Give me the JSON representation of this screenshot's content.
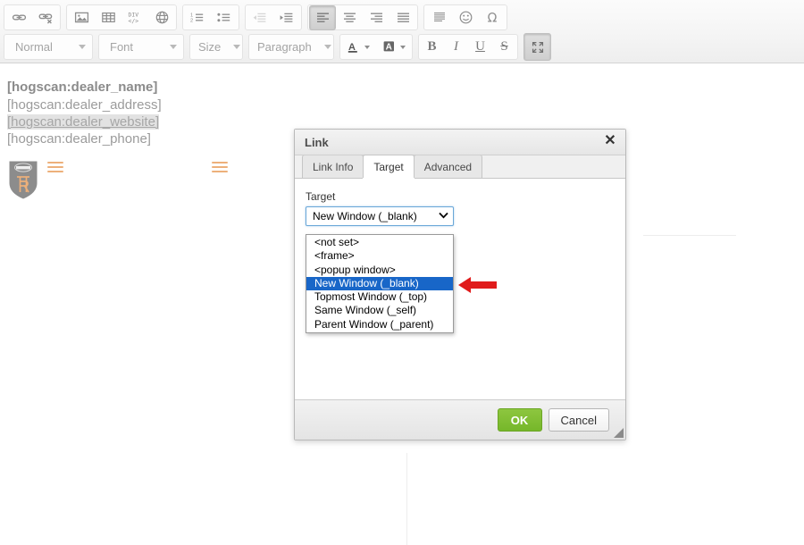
{
  "toolbar": {
    "row1_groups": [
      {
        "name": "link-group",
        "buttons": [
          {
            "icon": "link-icon",
            "label": "Link",
            "state": "normal"
          },
          {
            "icon": "unlink-icon",
            "label": "Unlink",
            "state": "normal"
          }
        ]
      },
      {
        "name": "insert-group",
        "buttons": [
          {
            "icon": "image-icon",
            "label": "Image",
            "state": "normal"
          },
          {
            "icon": "table-icon",
            "label": "Table",
            "state": "normal"
          },
          {
            "icon": "div-container-icon",
            "label": "Div Container",
            "state": "normal"
          },
          {
            "icon": "iframe-icon",
            "label": "IFrame",
            "state": "normal"
          }
        ]
      },
      {
        "name": "list-group",
        "buttons": [
          {
            "icon": "numbered-list-icon",
            "label": "Insert/Remove Numbered List",
            "state": "normal"
          },
          {
            "icon": "bulleted-list-icon",
            "label": "Insert/Remove Bulleted List",
            "state": "normal"
          }
        ]
      },
      {
        "name": "indent-group",
        "buttons": [
          {
            "icon": "outdent-icon",
            "label": "Decrease Indent",
            "state": "disabled"
          },
          {
            "icon": "indent-icon",
            "label": "Increase Indent",
            "state": "normal"
          }
        ]
      },
      {
        "name": "align-group",
        "buttons": [
          {
            "icon": "align-left-icon",
            "label": "Align Left",
            "state": "active"
          },
          {
            "icon": "align-center-icon",
            "label": "Center",
            "state": "normal"
          },
          {
            "icon": "align-right-icon",
            "label": "Align Right",
            "state": "normal"
          },
          {
            "icon": "align-justify-icon",
            "label": "Justify",
            "state": "normal"
          }
        ]
      },
      {
        "name": "misc-group",
        "buttons": [
          {
            "icon": "blockquote-icon",
            "label": "Block Quote",
            "state": "normal"
          },
          {
            "icon": "smiley-icon",
            "label": "Smiley",
            "state": "normal"
          },
          {
            "icon": "special-char-icon",
            "label": "Insert Special Character",
            "state": "normal"
          }
        ]
      }
    ],
    "combos": {
      "format": "Normal",
      "font": "Font",
      "size": "Size",
      "paragraph": "Paragraph"
    },
    "color_buttons": [
      {
        "icon": "text-color-icon",
        "label": "Text Color",
        "glyph": "A"
      },
      {
        "icon": "background-color-icon",
        "label": "Background Color",
        "glyph": "A"
      }
    ],
    "format_buttons": [
      {
        "icon": "bold-icon",
        "label": "Bold",
        "glyph": "B"
      },
      {
        "icon": "italic-icon",
        "label": "Italic",
        "glyph": "I"
      },
      {
        "icon": "underline-icon",
        "label": "Underline",
        "glyph": "U"
      },
      {
        "icon": "strikethrough-icon",
        "label": "Strike Through",
        "glyph": "S"
      }
    ],
    "maximize": {
      "icon": "maximize-icon",
      "label": "Maximize",
      "state": "normal"
    }
  },
  "editor": {
    "tokens": [
      "[hogscan:dealer_name]",
      "[hogscan:dealer_address]",
      "[hogscan:dealer_website]",
      "[hogscan:dealer_phone]"
    ],
    "logo_alt": "dealer-shield-logo"
  },
  "dialog": {
    "title": "Link",
    "close_label": "✕",
    "tabs": [
      {
        "label": "Link Info",
        "active": false
      },
      {
        "label": "Target",
        "active": true
      },
      {
        "label": "Advanced",
        "active": false
      }
    ],
    "target_field": {
      "label": "Target",
      "value": "New Window (_blank)",
      "chevron": "⌄",
      "options": [
        "<not set>",
        "<frame>",
        "<popup window>",
        "New Window (_blank)",
        "Topmost Window (_top)",
        "Same Window (_self)",
        "Parent Window (_parent)"
      ],
      "selected_index": 3
    },
    "buttons": {
      "ok": "OK",
      "cancel": "Cancel"
    }
  },
  "annotation": {
    "arrow": "red-left-arrow",
    "color": "#e01b1b"
  },
  "colors": {
    "accent_selection": "#1866c8",
    "ok_green": "#76b72a",
    "token_gray": "#9b9b9b",
    "logo_orange": "#edb07a"
  }
}
